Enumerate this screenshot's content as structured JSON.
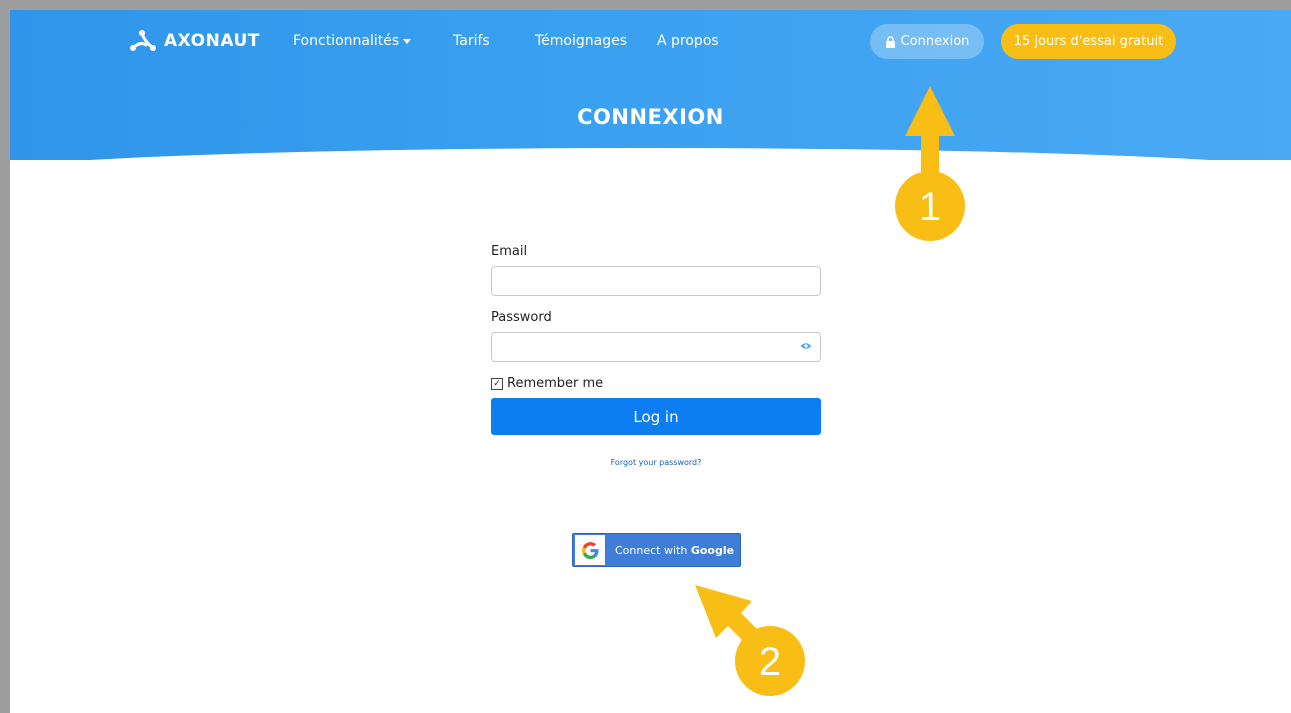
{
  "brand": {
    "name": "AXONAUT"
  },
  "nav": {
    "links": [
      "Fonctionnalités",
      "Tarifs",
      "Témoignages",
      "A propos"
    ],
    "login_label": "Connexion",
    "trial_label": "15 jours d'essai gratuit"
  },
  "hero": {
    "title": "CONNEXION"
  },
  "form": {
    "email_label": "Email",
    "email_value": "",
    "password_label": "Password",
    "password_value": "",
    "remember_label": "Remember me",
    "remember_checked": true,
    "login_button": "Log in",
    "forgot_link": "Forgot your password?"
  },
  "google": {
    "prefix": "Connect with ",
    "brand": "Google"
  },
  "annotations": {
    "marker1": "1",
    "marker2": "2"
  },
  "colors": {
    "hero_blue": "#3aa0f0",
    "accent_yellow": "#f8be16",
    "login_blue": "#0d7df2",
    "google_blue": "#3e7ed8"
  },
  "icons": [
    "axonaut-logo-icon",
    "lock-icon",
    "caret-down-icon",
    "eye-icon",
    "google-g-icon"
  ]
}
